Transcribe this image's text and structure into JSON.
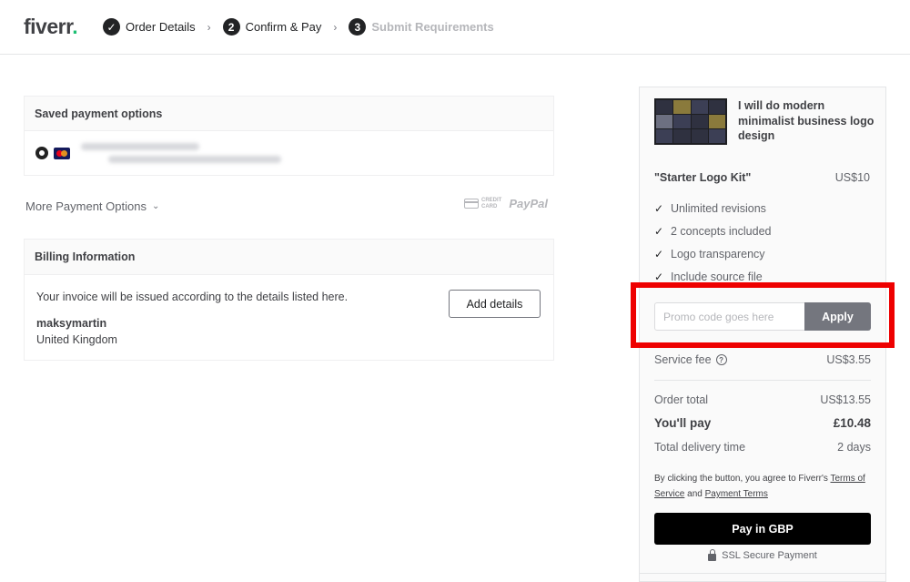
{
  "header": {
    "logo_text": "fiverr",
    "logo_dot": ".",
    "steps": [
      {
        "number": "✓",
        "label": "Order Details"
      },
      {
        "number": "2",
        "label": "Confirm & Pay"
      },
      {
        "number": "3",
        "label": "Submit Requirements"
      }
    ]
  },
  "payment": {
    "saved_title": "Saved payment options",
    "more_options_label": "More Payment Options",
    "credit_card_label_1": "CREDIT",
    "credit_card_label_2": "CARD",
    "paypal_label": "PayPal"
  },
  "billing": {
    "title": "Billing Information",
    "invoice_text": "Your invoice will be issued according to the details listed here.",
    "add_details_label": "Add details",
    "name": "maksymartin",
    "country": "United Kingdom"
  },
  "summary": {
    "gig_title": "I will do modern minimalist business logo design",
    "package_name": "\"Starter Logo Kit\"",
    "package_price": "US$10",
    "features": [
      "Unlimited revisions",
      "2 concepts included",
      "Logo transparency",
      "Include source file"
    ],
    "promo_placeholder": "Promo code goes here",
    "apply_label": "Apply",
    "service_fee_label": "Service fee",
    "service_fee_value": "US$3.55",
    "order_total_label": "Order total",
    "order_total_value": "US$13.55",
    "you_pay_label": "You'll pay",
    "you_pay_value": "£10.48",
    "delivery_label": "Total delivery time",
    "delivery_value": "2 days",
    "terms_prefix": "By clicking the button, you agree to Fiverr's",
    "terms_link": "Terms of Service",
    "terms_and": "and",
    "payment_terms_link": "Payment Terms",
    "pay_button_label": "Pay in GBP",
    "ssl_label": "SSL Secure Payment"
  },
  "colors": {
    "brand_green": "#1dbf73",
    "highlight_red": "#ee0000",
    "pay_button": "#000000",
    "apply_button": "#74767e"
  }
}
